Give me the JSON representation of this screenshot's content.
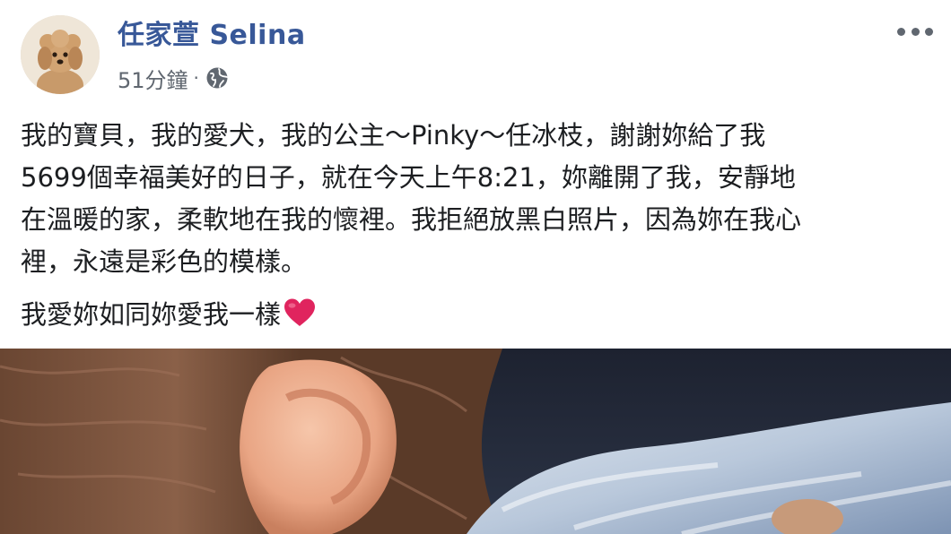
{
  "post": {
    "author": {
      "name": "任家萱 Selina",
      "avatar_icon": "dog-avatar-icon"
    },
    "meta": {
      "timestamp": "51分鐘",
      "separator": "·",
      "privacy_icon": "globe-icon"
    },
    "menu_icon": "more-options-icon",
    "paragraphs": [
      [
        "我的寶貝，我的愛犬，我的公主～Pinky～任冰枝，謝謝妳給了我",
        "5699個幸福美好的日子，就在今天上午8:21，妳離開了我，安靜地",
        "在溫暖的家，柔軟地在我的懷裡。我拒絕放黑白照片，因為妳在我心",
        "裡，永遠是彩色的模樣。"
      ],
      [
        "我愛妳如同妳愛我一樣"
      ]
    ],
    "heart_emoji": "red-heart-icon",
    "photo_icon": "post-photo-image"
  },
  "colors": {
    "author_link": "#385898",
    "meta_text": "#606770",
    "body_text": "#1c1e21",
    "heart": "#e0245e"
  }
}
